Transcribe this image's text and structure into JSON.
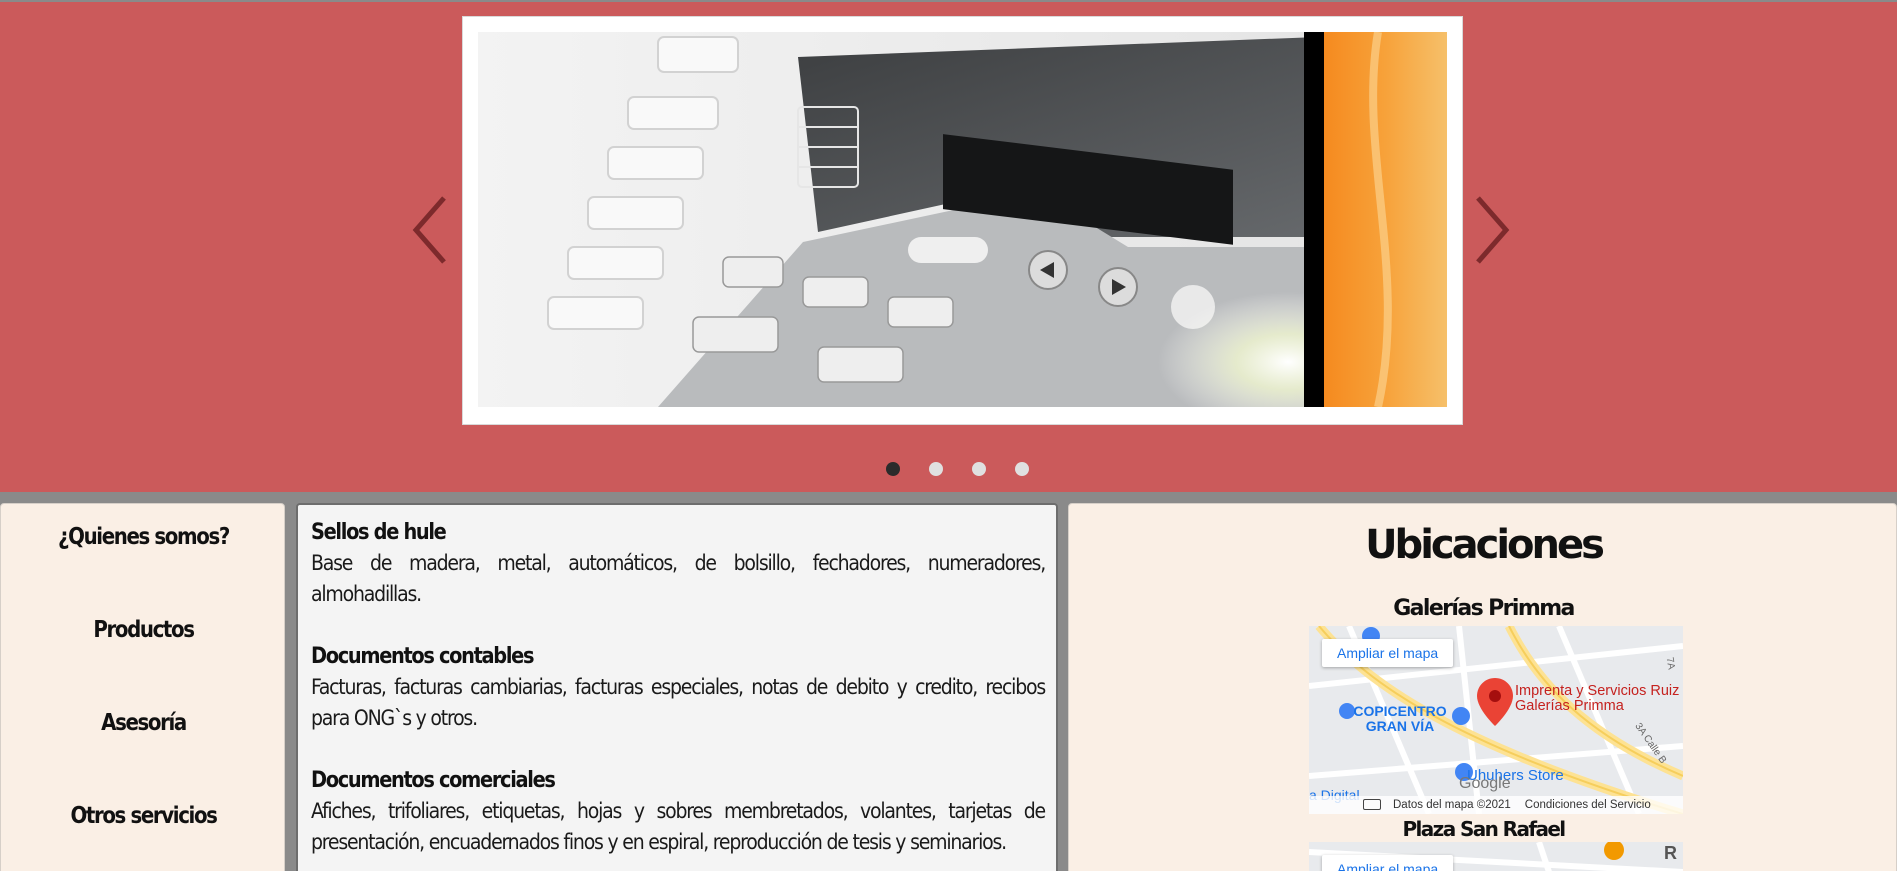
{
  "carousel": {
    "prev_icon": "chevron-left-icon",
    "next_icon": "chevron-right-icon",
    "slides_total": 4,
    "active_slide": 1,
    "accent_color": "#cb5a5b"
  },
  "nav": {
    "items": [
      {
        "label": "¿Quienes somos?"
      },
      {
        "label": "Productos"
      },
      {
        "label": "Asesoría"
      },
      {
        "label": "Otros servicios"
      }
    ]
  },
  "services": [
    {
      "title": "Sellos de hule",
      "text": "Base de madera, metal, automáticos, de bolsillo, fechadores, numeradores, almohadillas."
    },
    {
      "title": "Documentos contables",
      "text": "Facturas, facturas cambiarias, facturas especiales, notas de debito y credito, recibos para ONG`s y otros."
    },
    {
      "title": "Documentos comerciales",
      "text": "Afiches, trifoliares, etiquetas, hojas y sobres membretados, volantes, tarjetas de presentación, encuadernados finos y en espiral, reproducción de tesis y seminarios."
    }
  ],
  "locations": {
    "title": "Ubicaciones",
    "branches": [
      {
        "name": "Galerías Primma",
        "map": {
          "button": "Ampliar el mapa",
          "pin_label": "Imprenta y Servicios Ruiz Galerías Primma",
          "poi_1": "COPICENTRO GRAN VÍA",
          "poi_2": "Uhuhers Store",
          "poi_3": "a Digital",
          "street_1": "3A Calle B",
          "street_2": "7A",
          "logo": "Google",
          "data_label": "Datos del mapa ©2021",
          "terms_label": "Condiciones del Servicio"
        }
      },
      {
        "name": "Plaza San Rafael",
        "map": {
          "button": "Ampliar el mapa",
          "corner_label": "R"
        }
      }
    ]
  }
}
